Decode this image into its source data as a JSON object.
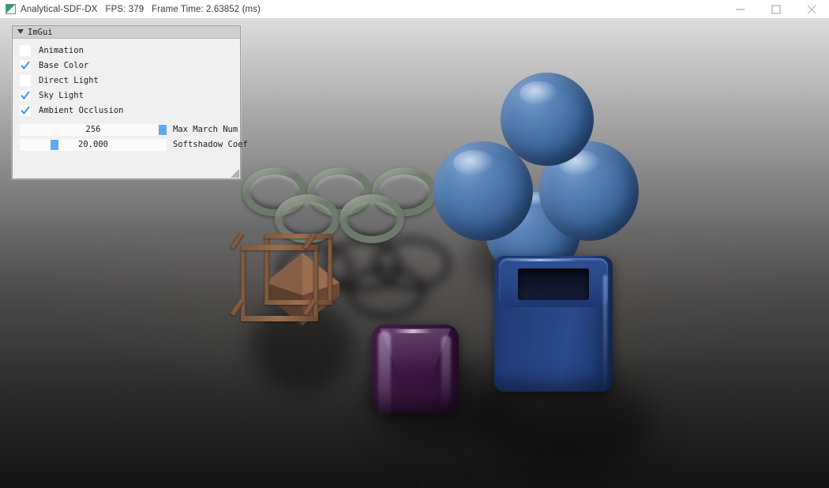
{
  "window": {
    "title": "Analytical-SDF-DX",
    "fps_label": "FPS: 379",
    "frametime_label": "Frame Time: 2.63852 (ms)",
    "icon": "app-icon",
    "controls": {
      "minimize": "minimize-icon",
      "maximize": "maximize-icon",
      "close": "close-icon"
    }
  },
  "imgui": {
    "title": "ImGui",
    "collapse_arrow": "chevron-down-icon",
    "checkboxes": [
      {
        "label": "Animation",
        "checked": false
      },
      {
        "label": "Base Color",
        "checked": true
      },
      {
        "label": "Direct Light",
        "checked": false
      },
      {
        "label": "Sky Light",
        "checked": true
      },
      {
        "label": "Ambient Occlusion",
        "checked": true
      }
    ],
    "sliders": [
      {
        "label": "Max March Num",
        "value": "256",
        "fraction": 1.0
      },
      {
        "label": "Softshadow Coef",
        "value": "20.000",
        "fraction": 0.22
      }
    ],
    "resize_grip": "resize-grip-icon",
    "colors": {
      "panel_bg": "#f0f0f0",
      "title_bg": "#cfcfcf",
      "accent": "#5fa9f0",
      "border": "#9b9b9b"
    }
  },
  "scene": {
    "name": "analytical-sdf-raymarch-scene",
    "background_top": "#dcdcdc",
    "background_bottom": "#141313",
    "objects": [
      {
        "name": "sphere-cluster",
        "color": "#40699e"
      },
      {
        "name": "open-box-blue",
        "color": "#24407e"
      },
      {
        "name": "torus-rings",
        "color": "#6e7a6c",
        "count": 5
      },
      {
        "name": "wireframe-cube",
        "color": "#8a6145"
      },
      {
        "name": "octahedron",
        "color": "#7a5336"
      },
      {
        "name": "rounded-cube-purple",
        "color": "#3b1741"
      }
    ]
  }
}
